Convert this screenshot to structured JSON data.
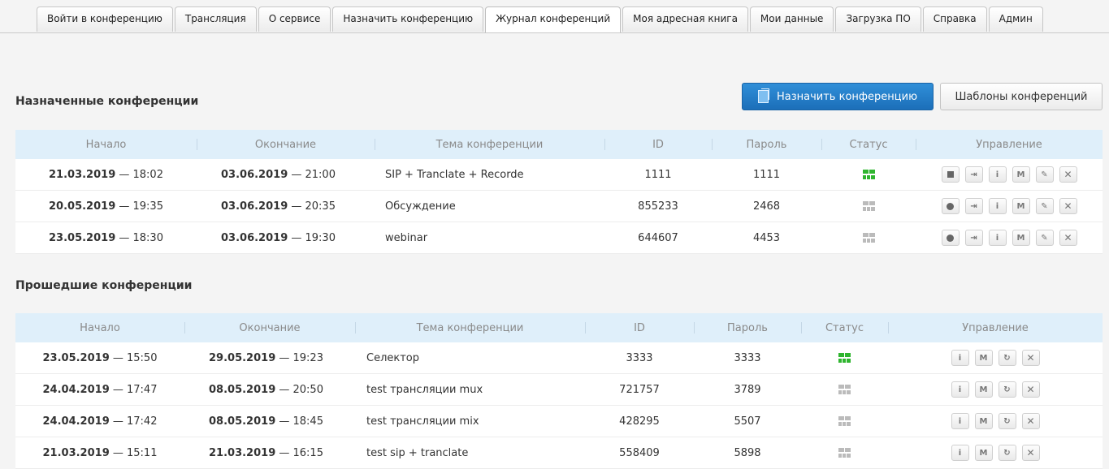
{
  "tabs": [
    {
      "label": "Войти в конференцию",
      "active": false
    },
    {
      "label": "Трансляция",
      "active": false
    },
    {
      "label": "О сервисе",
      "active": false
    },
    {
      "label": "Назначить конференцию",
      "active": false
    },
    {
      "label": "Журнал конференций",
      "active": true
    },
    {
      "label": "Моя адресная книга",
      "active": false
    },
    {
      "label": "Мои данные",
      "active": false
    },
    {
      "label": "Загрузка ПО",
      "active": false
    },
    {
      "label": "Справка",
      "active": false
    },
    {
      "label": "Админ",
      "active": false
    }
  ],
  "scheduled": {
    "title": "Назначенные конференции",
    "schedule_button": "Назначить конференцию",
    "templates_button": "Шаблоны конференций",
    "columns": [
      "Начало",
      "Окончание",
      "Тема конференции",
      "ID",
      "Пароль",
      "Статус",
      "Управление"
    ],
    "rows": [
      {
        "start_date": "21.03.2019",
        "start_time": " — 18:02",
        "end_date": "03.06.2019",
        "end_time": " — 21:00",
        "topic": "SIP + Tranclate + Recorde",
        "id": "1111",
        "password": "1111",
        "status": "active",
        "rec": "stop"
      },
      {
        "start_date": "20.05.2019",
        "start_time": " — 19:35",
        "end_date": "03.06.2019",
        "end_time": " — 20:35",
        "topic": "Обсуждение",
        "id": "855233",
        "password": "2468",
        "status": "inactive",
        "rec": "record"
      },
      {
        "start_date": "23.05.2019",
        "start_time": " — 18:30",
        "end_date": "03.06.2019",
        "end_time": " — 19:30",
        "topic": "webinar",
        "id": "644607",
        "password": "4453",
        "status": "inactive",
        "rec": "record"
      }
    ],
    "action_icons": [
      "stop-icon",
      "join-icon",
      "info-icon",
      "moderator-icon",
      "edit-icon",
      "delete-icon"
    ]
  },
  "past": {
    "title": "Прошедшие конференции",
    "columns": [
      "Начало",
      "Окончание",
      "Тема конференции",
      "ID",
      "Пароль",
      "Статус",
      "Управление"
    ],
    "rows": [
      {
        "start_date": "23.05.2019",
        "start_time": " — 15:50",
        "end_date": "29.05.2019",
        "end_time": " — 19:23",
        "topic": "Селектор",
        "id": "3333",
        "password": "3333",
        "status": "active"
      },
      {
        "start_date": "24.04.2019",
        "start_time": " — 17:47",
        "end_date": "08.05.2019",
        "end_time": " — 20:50",
        "topic": "test трансляции mux",
        "id": "721757",
        "password": "3789",
        "status": "inactive"
      },
      {
        "start_date": "24.04.2019",
        "start_time": " — 17:42",
        "end_date": "08.05.2019",
        "end_time": " — 18:45",
        "topic": "test трансляции mix",
        "id": "428295",
        "password": "5507",
        "status": "inactive"
      },
      {
        "start_date": "21.03.2019",
        "start_time": " — 15:11",
        "end_date": "21.03.2019",
        "end_time": " — 16:15",
        "topic": "test sip + tranclate",
        "id": "558409",
        "password": "5898",
        "status": "inactive"
      }
    ],
    "action_icons": [
      "info-icon",
      "moderator-icon",
      "restart-icon",
      "delete-icon"
    ]
  },
  "icon_glyphs": {
    "join": "⇥",
    "info": "i",
    "moderator": "M",
    "edit": "✎",
    "delete": "✕",
    "restart": "↻"
  },
  "colors": {
    "accent": "#1f77c4",
    "header_bg": "#dfeffa",
    "status_active": "#2fb52f",
    "status_inactive": "#bbbbbb"
  }
}
